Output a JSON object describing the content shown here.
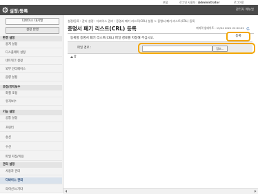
{
  "topbar": {
    "portal": "포털",
    "login_user": "로그인 사용자 :",
    "user_name": "Administrator",
    "logout": "로그아웃"
  },
  "titlebar": {
    "icon": "gear-icon",
    "title": "설정/등록",
    "portal_link": "관리자 메뉴얼"
  },
  "sidebar": {
    "device_status_btn": "디바이스 대기열",
    "settings_reflect_btn": "설정 반영",
    "sections": [
      {
        "label": "환경 설정",
        "items": [
          "용지 설정",
          "디스플레이 설정",
          "네트워크 설정",
          "외부 인터페이스",
          "음량 설정"
        ]
      },
      {
        "label": "조정/유지보수",
        "items": [
          "화질 조정",
          "유지보수"
        ]
      },
      {
        "label": "기능 설정",
        "items": [
          "공통 설정",
          "프린터",
          "송신",
          "수신",
          "파일 저장/이용"
        ]
      },
      {
        "label": "관리 설정",
        "items": [
          "사용자 관리",
          "디바이스 관리",
          "라이선스/기타"
        ]
      }
    ],
    "active_item": "디바이스 관리"
  },
  "main": {
    "breadcrumb": "설정/등록 : 관리 설정 : 디바이스 관리 : 증명서 폐기 리스트(CRL) 설정 > 증명서 폐기 리스트(CRL) 등록",
    "page_title": "증명서 폐기 리스트(CRL) 등록",
    "updated_label": "마지막 업데이트 : 15/04 2021 22:50:02",
    "instruction": "등록할 증명서 폐기 리스트(CRL) 파일 경로를 지정해 주십시오.",
    "register_label": "등록",
    "file_label": "파일 경로 :",
    "file_value": "",
    "browse_label": "참조...",
    "to_top": "앞"
  }
}
